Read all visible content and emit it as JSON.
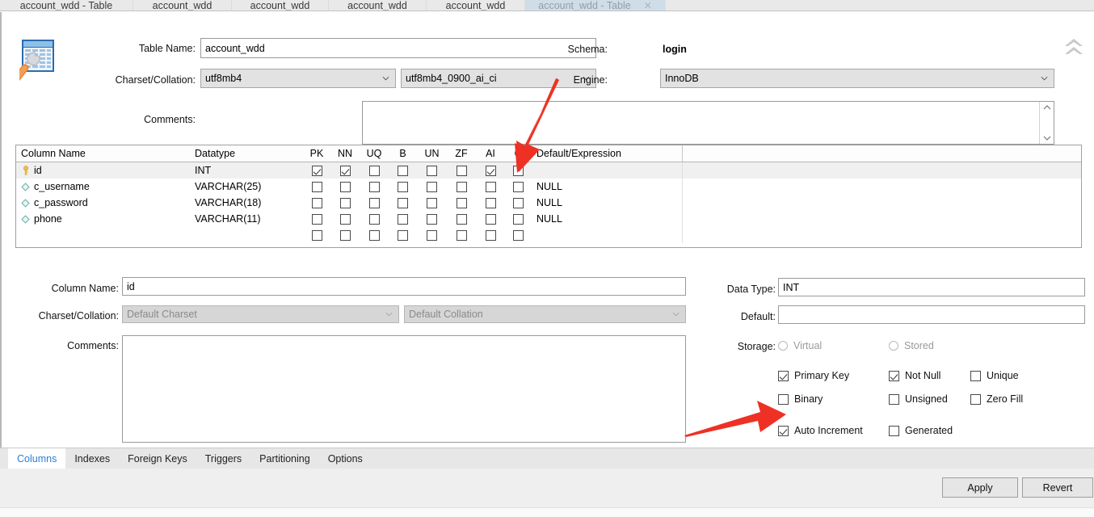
{
  "window": {
    "tabs": [
      {
        "label": "account_wdd - Table",
        "active": false
      },
      {
        "label": "account_wdd",
        "active": false
      },
      {
        "label": "account_wdd",
        "active": false
      },
      {
        "label": "account_wdd",
        "active": false
      },
      {
        "label": "account_wdd",
        "active": false
      },
      {
        "label": "account_wdd - Table",
        "active": true,
        "close": "✕"
      }
    ]
  },
  "header": {
    "table_name_label": "Table Name:",
    "table_name_value": "account_wdd",
    "charset_label": "Charset/Collation:",
    "charset_value": "utf8mb4",
    "collation_value": "utf8mb4_0900_ai_ci",
    "schema_label": "Schema:",
    "schema_value": "login",
    "engine_label": "Engine:",
    "engine_value": "InnoDB",
    "comments_label": "Comments:",
    "comments_value": ""
  },
  "grid": {
    "headers": [
      "Column Name",
      "Datatype",
      "PK",
      "NN",
      "UQ",
      "B",
      "UN",
      "ZF",
      "AI",
      "G",
      "Default/Expression"
    ],
    "rows": [
      {
        "icon": "key-icon",
        "name": "id",
        "datatype": "INT",
        "pk": true,
        "nn": true,
        "uq": false,
        "b": false,
        "un": false,
        "zf": false,
        "ai": true,
        "g": false,
        "default": "",
        "selected": true
      },
      {
        "icon": "diamond-icon",
        "name": "c_username",
        "datatype": "VARCHAR(25)",
        "pk": false,
        "nn": false,
        "uq": false,
        "b": false,
        "un": false,
        "zf": false,
        "ai": false,
        "g": false,
        "default": "NULL",
        "selected": false
      },
      {
        "icon": "diamond-icon",
        "name": "c_password",
        "datatype": "VARCHAR(18)",
        "pk": false,
        "nn": false,
        "uq": false,
        "b": false,
        "un": false,
        "zf": false,
        "ai": false,
        "g": false,
        "default": "NULL",
        "selected": false
      },
      {
        "icon": "diamond-icon",
        "name": "phone",
        "datatype": "VARCHAR(11)",
        "pk": false,
        "nn": false,
        "uq": false,
        "b": false,
        "un": false,
        "zf": false,
        "ai": false,
        "g": false,
        "default": "NULL",
        "selected": false
      },
      {
        "icon": "",
        "name": "",
        "datatype": "",
        "pk": false,
        "nn": false,
        "uq": false,
        "b": false,
        "un": false,
        "zf": false,
        "ai": false,
        "g": false,
        "default": "",
        "selected": false
      }
    ]
  },
  "detail": {
    "column_name_label": "Column Name:",
    "column_name_value": "id",
    "charset_label": "Charset/Collation:",
    "charset_placeholder": "Default Charset",
    "collation_placeholder": "Default Collation",
    "comments_label": "Comments:",
    "comments_value": "",
    "data_type_label": "Data Type:",
    "data_type_value": "INT",
    "default_label": "Default:",
    "default_value": "",
    "storage_label": "Storage:",
    "storage_virtual": "Virtual",
    "storage_stored": "Stored",
    "flags": [
      {
        "label": "Primary Key",
        "checked": true
      },
      {
        "label": "Not Null",
        "checked": true
      },
      {
        "label": "Unique",
        "checked": false
      },
      {
        "label": "Binary",
        "checked": false
      },
      {
        "label": "Unsigned",
        "checked": false
      },
      {
        "label": "Zero Fill",
        "checked": false
      },
      {
        "label": "Auto Increment",
        "checked": true
      },
      {
        "label": "Generated",
        "checked": false
      }
    ]
  },
  "bottom_tabs": [
    {
      "label": "Columns",
      "active": true
    },
    {
      "label": "Indexes",
      "active": false
    },
    {
      "label": "Foreign Keys",
      "active": false
    },
    {
      "label": "Triggers",
      "active": false
    },
    {
      "label": "Partitioning",
      "active": false
    },
    {
      "label": "Options",
      "active": false
    }
  ],
  "buttons": {
    "apply": "Apply",
    "revert": "Revert"
  },
  "annotations": {
    "arrow_color": "#ee3124",
    "arrow_ai_target": "AI",
    "arrow_auto_increment_target": "Auto Increment"
  }
}
